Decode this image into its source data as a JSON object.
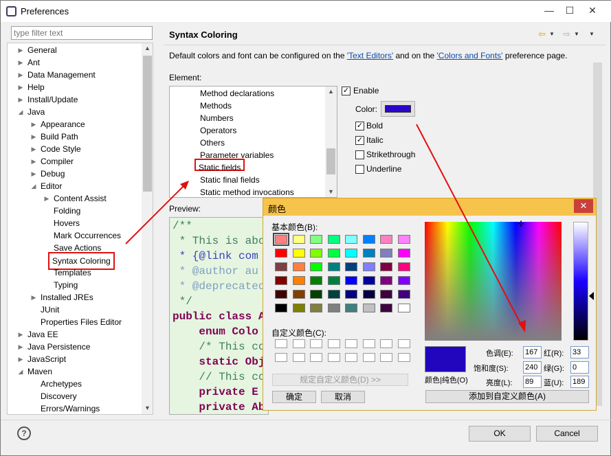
{
  "window": {
    "title": "Preferences",
    "minimize": "—",
    "maximize": "☐",
    "close": "✕"
  },
  "filter": {
    "placeholder": "type filter text"
  },
  "tree": [
    {
      "label": "General",
      "indent": 0,
      "tw": "▶"
    },
    {
      "label": "Ant",
      "indent": 0,
      "tw": "▶"
    },
    {
      "label": "Data Management",
      "indent": 0,
      "tw": "▶"
    },
    {
      "label": "Help",
      "indent": 0,
      "tw": "▶"
    },
    {
      "label": "Install/Update",
      "indent": 0,
      "tw": "▶"
    },
    {
      "label": "Java",
      "indent": 0,
      "tw": "◢"
    },
    {
      "label": "Appearance",
      "indent": 1,
      "tw": "▶"
    },
    {
      "label": "Build Path",
      "indent": 1,
      "tw": "▶"
    },
    {
      "label": "Code Style",
      "indent": 1,
      "tw": "▶"
    },
    {
      "label": "Compiler",
      "indent": 1,
      "tw": "▶"
    },
    {
      "label": "Debug",
      "indent": 1,
      "tw": "▶"
    },
    {
      "label": "Editor",
      "indent": 1,
      "tw": "◢"
    },
    {
      "label": "Content Assist",
      "indent": 2,
      "tw": "▶"
    },
    {
      "label": "Folding",
      "indent": 2,
      "tw": ""
    },
    {
      "label": "Hovers",
      "indent": 2,
      "tw": ""
    },
    {
      "label": "Mark Occurrences",
      "indent": 2,
      "tw": ""
    },
    {
      "label": "Save Actions",
      "indent": 2,
      "tw": ""
    },
    {
      "label": "Syntax Coloring",
      "indent": 2,
      "tw": "",
      "selected": true
    },
    {
      "label": "Templates",
      "indent": 2,
      "tw": ""
    },
    {
      "label": "Typing",
      "indent": 2,
      "tw": ""
    },
    {
      "label": "Installed JREs",
      "indent": 1,
      "tw": "▶"
    },
    {
      "label": "JUnit",
      "indent": 1,
      "tw": ""
    },
    {
      "label": "Properties Files Editor",
      "indent": 1,
      "tw": ""
    },
    {
      "label": "Java EE",
      "indent": 0,
      "tw": "▶"
    },
    {
      "label": "Java Persistence",
      "indent": 0,
      "tw": "▶"
    },
    {
      "label": "JavaScript",
      "indent": 0,
      "tw": "▶"
    },
    {
      "label": "Maven",
      "indent": 0,
      "tw": "◢"
    },
    {
      "label": "Archetypes",
      "indent": 1,
      "tw": ""
    },
    {
      "label": "Discovery",
      "indent": 1,
      "tw": ""
    },
    {
      "label": "Errors/Warnings",
      "indent": 1,
      "tw": ""
    }
  ],
  "page": {
    "title": "Syntax Coloring",
    "desc_prefix": "Default colors and font can be configured on the ",
    "link1": "'Text Editors'",
    "desc_mid": " and on the ",
    "link2": "'Colors and Fonts'",
    "desc_suffix": " preference page.",
    "element_label": "Element:",
    "preview_label": "Preview:"
  },
  "elements": [
    "Method declarations",
    "Methods",
    "Numbers",
    "Operators",
    "Others",
    "Parameter variables",
    "Static fields",
    "Static final fields",
    "Static method invocations"
  ],
  "selected_element": "Static fields",
  "options": {
    "enable": "Enable",
    "enable_checked": true,
    "color_label": "Color:",
    "color": "#2a06c9",
    "bold": "Bold",
    "bold_checked": true,
    "italic": "Italic",
    "italic_checked": true,
    "strike": "Strikethrough",
    "strike_checked": false,
    "underline": "Underline",
    "underline_checked": false
  },
  "preview_lines": [
    {
      "text": "/**",
      "color": "#3f7f5f"
    },
    {
      "text": " * This is abo",
      "color": "#3f7f5f"
    },
    {
      "text": " * {@link com",
      "color": "#3f3fbf"
    },
    {
      "text": " * @author au",
      "color": "#7f9fbf"
    },
    {
      "text": " * @deprecated",
      "color": "#7f9fbf"
    },
    {
      "text": " */",
      "color": "#3f7f5f"
    },
    {
      "text": "public class A",
      "color": "#7f0055"
    },
    {
      "text": "    enum Colo",
      "color": "#7f0055"
    },
    {
      "text": "    /* This co",
      "color": "#3f7f5f"
    },
    {
      "text": "    static Obj",
      "color": "#7f0055"
    },
    {
      "text": "    // This co",
      "color": "#3f7f5f"
    },
    {
      "text": "    private E",
      "color": "#7f0055"
    },
    {
      "text": "    private Ab",
      "color": "#7f0055"
    }
  ],
  "color_dialog": {
    "title": "颜色",
    "basic_label": "基本颜色(B):",
    "custom_label": "自定义颜色(C):",
    "define_btn": "规定自定义颜色(D) >>",
    "ok": "确定",
    "cancel": "取消",
    "solid_label": "颜色|纯色(O)",
    "add_btn": "添加到自定义颜色(A)",
    "hue_label": "色调(E):",
    "hue": "167",
    "sat_label": "饱和度(S):",
    "sat": "240",
    "lum_label": "亮度(L):",
    "lum": "89",
    "red_label": "红(R):",
    "red": "33",
    "green_label": "绿(G):",
    "green": "0",
    "blue_label": "蓝(U):",
    "blue": "189",
    "current_color": "#2106bd",
    "basic_colors": [
      "#ff8080",
      "#ffff80",
      "#80ff80",
      "#00ff80",
      "#80ffff",
      "#0080ff",
      "#ff80c0",
      "#ff80ff",
      "#ff0000",
      "#ffff00",
      "#80ff00",
      "#00ff40",
      "#00ffff",
      "#0080c0",
      "#8080c0",
      "#ff00ff",
      "#804040",
      "#ff8040",
      "#00ff00",
      "#008080",
      "#004080",
      "#8080ff",
      "#800040",
      "#ff0080",
      "#800000",
      "#ff8000",
      "#008000",
      "#008040",
      "#0000ff",
      "#0000a0",
      "#800080",
      "#8000ff",
      "#400000",
      "#804000",
      "#004000",
      "#004040",
      "#000080",
      "#000040",
      "#400040",
      "#400080",
      "#000000",
      "#808000",
      "#808040",
      "#808080",
      "#408080",
      "#c0c0c0",
      "#400040",
      "#ffffff"
    ]
  },
  "footer": {
    "help": "?",
    "ok": "OK",
    "cancel": "Cancel"
  }
}
